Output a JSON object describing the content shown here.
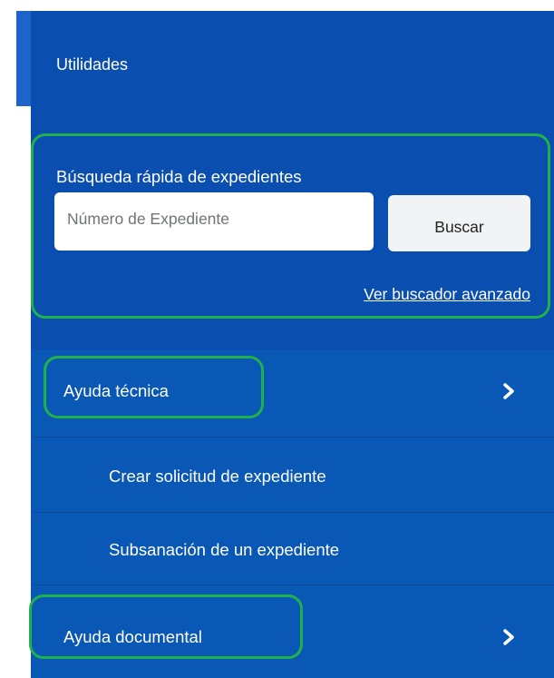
{
  "header": {
    "title": "Utilidades"
  },
  "quick_search": {
    "title": "Búsqueda rápida de expedientes",
    "input_placeholder": "Número de Expediente",
    "input_value": "",
    "button_label": "Buscar",
    "advanced_link": "Ver buscador avanzado"
  },
  "menu": {
    "items": [
      {
        "label": "Ayuda técnica",
        "icon": "chevron-right-icon",
        "subitems": [
          {
            "label": "Crear solicitud de expediente"
          },
          {
            "label": "Subsanación de un expediente"
          }
        ]
      },
      {
        "label": "Ayuda documental",
        "icon": "chevron-right-icon"
      }
    ]
  },
  "colors": {
    "panel_blue": "#0a4fb0",
    "menu_blue": "#0a58b6",
    "highlight_green": "#21b14c",
    "text_white": "#ffffff"
  }
}
